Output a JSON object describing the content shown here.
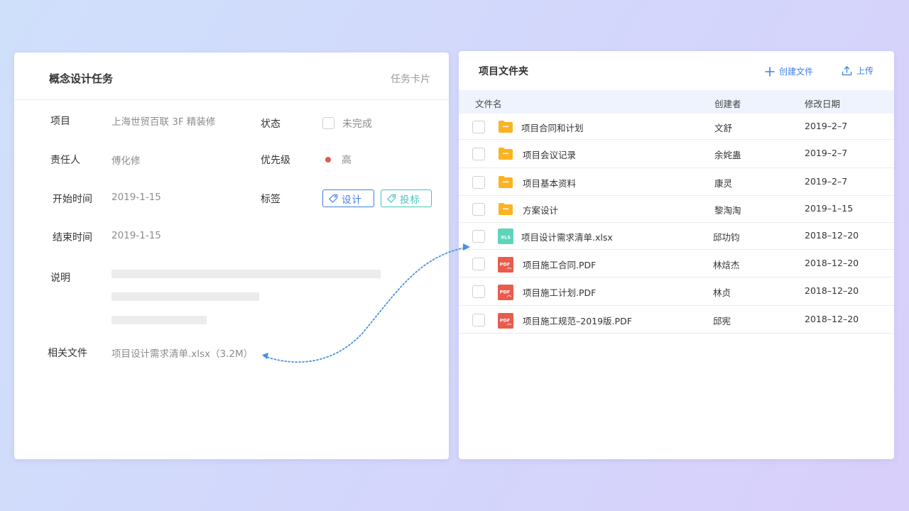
{
  "task_card": {
    "title": "概念设计任务",
    "subtitle": "任务卡片",
    "fields": {
      "project_label": "项目",
      "project_value": "上海世贸百联 3F 精装修",
      "status_label": "状态",
      "status_value": "未完成",
      "owner_label": "责任人",
      "owner_value": "傅化修",
      "priority_label": "优先级",
      "priority_value": "高",
      "start_label": "开始时间",
      "start_value": "2019-1-15",
      "tags_label": "标签",
      "end_label": "结束时间",
      "end_value": "2019-1-15",
      "desc_label": "说明",
      "files_label": "相关文件",
      "files_value": "项目设计需求清单.xlsx（3.2M）"
    },
    "tags": [
      "设计",
      "投标"
    ],
    "colors": {
      "priority_high": "#e05a4f",
      "tag_design": "#3f7fe0",
      "tag_bid": "#46c2bc"
    }
  },
  "folder": {
    "title": "项目文件夹",
    "create_label": "创建文件",
    "upload_label": "上传",
    "columns": {
      "name": "文件名",
      "creator": "创建者",
      "date": "修改日期"
    },
    "rows": [
      {
        "type": "folder",
        "name": "项目合同和计划",
        "creator": "文舒",
        "date": "2019–2–7"
      },
      {
        "type": "folder",
        "name": "项目会议记录",
        "creator": "余姹蛊",
        "date": "2019–2–7"
      },
      {
        "type": "folder",
        "name": "项目基本资料",
        "creator": "康灵",
        "date": "2019–2–7"
      },
      {
        "type": "folder",
        "name": "方案设计",
        "creator": "黎淘淘",
        "date": "2019–1–15"
      },
      {
        "type": "xls",
        "name": "项目设计需求清单.xlsx",
        "creator": "邱功钧",
        "date": "2018–12–20"
      },
      {
        "type": "pdf",
        "name": "项目施工合同.PDF",
        "creator": "林焓杰",
        "date": "2018–12–20"
      },
      {
        "type": "pdf",
        "name": "项目施工计划.PDF",
        "creator": "林贞",
        "date": "2018–12–20"
      },
      {
        "type": "pdf",
        "name": "项目施工规范–2019版.PDF",
        "creator": "邱宪",
        "date": "2018–12–20"
      }
    ],
    "icon_text": {
      "xls": "XLS",
      "pdf": "PDF"
    },
    "colors": {
      "accent": "#3f7fe0",
      "folder": "#fbb321",
      "xls": "#5fd4bd",
      "pdf": "#e85b4d",
      "header_bg": "#eef3fd"
    }
  }
}
